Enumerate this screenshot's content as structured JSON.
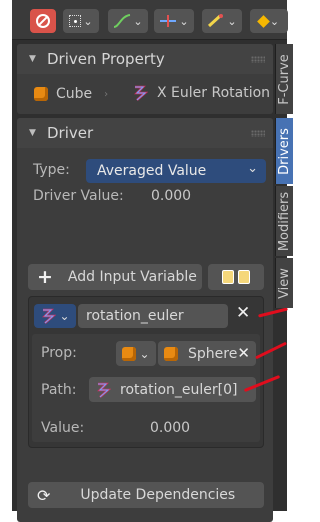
{
  "driven_property": {
    "title": "Driven Property",
    "object": "Cube",
    "property": "X Euler Rotation"
  },
  "driver": {
    "title": "Driver",
    "type_label": "Type:",
    "type_value": "Averaged Value",
    "value_label": "Driver Value:",
    "value": "0.000",
    "add_variable": "Add Input Variable",
    "variable": {
      "name": "rotation_euler",
      "prop_label": "Prop:",
      "prop_value": "Sphere",
      "path_label": "Path:",
      "path_value": "rotation_euler[0]",
      "value_label": "Value:",
      "value": "0.000"
    },
    "update": "Update Dependencies"
  },
  "side_tabs": [
    "F-Curve",
    "Drivers",
    "Modifiers",
    "View"
  ],
  "colors": {
    "accent": "#4772b3",
    "annotation": "#e00d1d",
    "object_orange": "#e88a12"
  }
}
